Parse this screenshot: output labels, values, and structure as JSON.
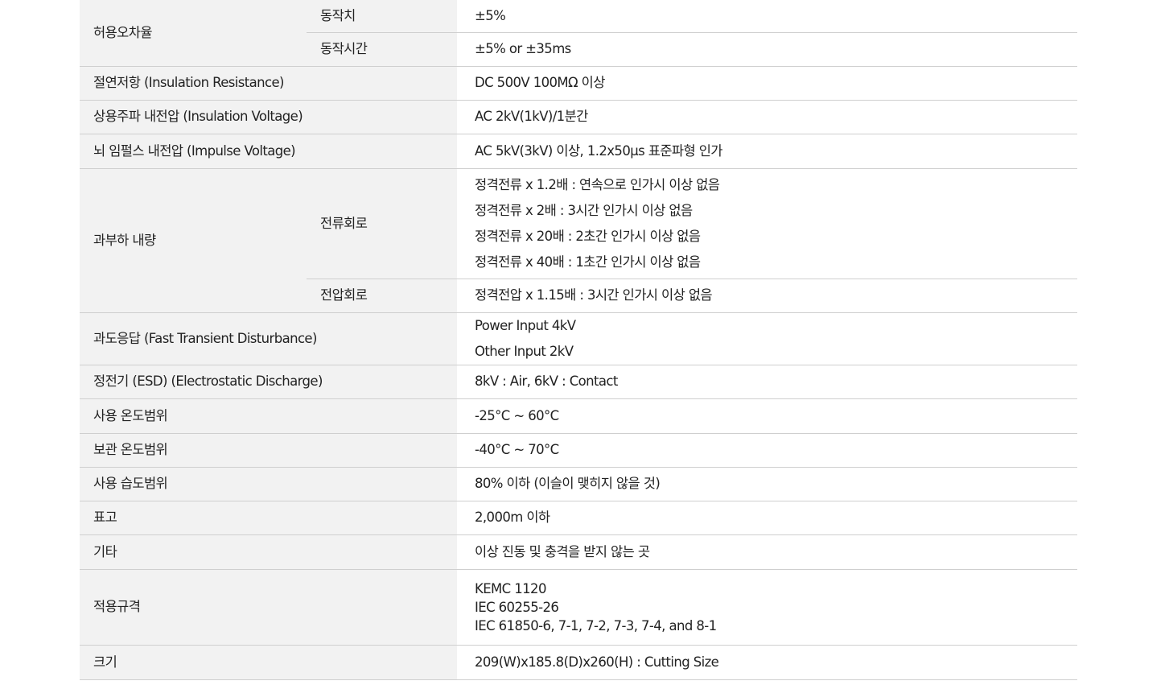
{
  "rows": {
    "tolerance": {
      "name": "허용오차율",
      "sub1": {
        "label": "동작치",
        "value": "±5%"
      },
      "sub2": {
        "label": "동작시간",
        "value": "±5% or ±35ms"
      }
    },
    "insulation_resistance": {
      "name": "절연저항 (Insulation Resistance)",
      "value": "DC 500V 100MΩ 이상"
    },
    "insulation_voltage": {
      "name": "상용주파 내전압 (Insulation Voltage)",
      "value": "AC 2kV(1kV)/1분간"
    },
    "impulse_voltage": {
      "name": "뇌 임펄스 내전압 (Impulse Voltage)",
      "value": "AC 5kV(3kV) 이상, 1.2x50μs 표준파형 인가"
    },
    "overload": {
      "name": "과부하 내량",
      "current": {
        "label": "전류회로",
        "lines": [
          "정격전류 x 1.2배 : 연속으로 인가시 이상 없음",
          "정격전류 x 2배 : 3시간 인가시 이상 없음",
          "정격전류 x 20배 : 2초간 인가시 이상 없음",
          "정격전류 x 40배 : 1초간 인가시 이상 없음"
        ]
      },
      "voltage": {
        "label": "전압회로",
        "value": "정격전압 x 1.15배 : 3시간 인가시 이상 없음"
      }
    },
    "fast_transient": {
      "name": "과도응답 (Fast Transient Disturbance)",
      "lines": [
        "Power Input 4kV",
        "Other Input 2kV"
      ]
    },
    "esd": {
      "name": "정전기 (ESD) (Electrostatic Discharge)",
      "value": "8kV : Air, 6kV : Contact"
    },
    "operating_temp": {
      "name": "사용 온도범위",
      "value": "-25°C ~ 60°C"
    },
    "storage_temp": {
      "name": "보관 온도범위",
      "value": "-40°C ~ 70°C"
    },
    "humidity": {
      "name": "사용 습도범위",
      "value": "80% 이하 (이슬이 맺히지 않을 것)"
    },
    "altitude": {
      "name": "표고",
      "value": "2,000m 이하"
    },
    "other": {
      "name": "기타",
      "value": "이상 진동 및 충격을 받지 않는 곳"
    },
    "standards": {
      "name": "적용규격",
      "lines": [
        "KEMC 1120",
        "IEC 60255-26",
        "IEC 61850-6, 7-1, 7-2, 7-3, 7-4, and 8-1"
      ]
    },
    "size": {
      "name": "크기",
      "value": "209(W)x185.8(D)x260(H) : Cutting Size"
    }
  }
}
